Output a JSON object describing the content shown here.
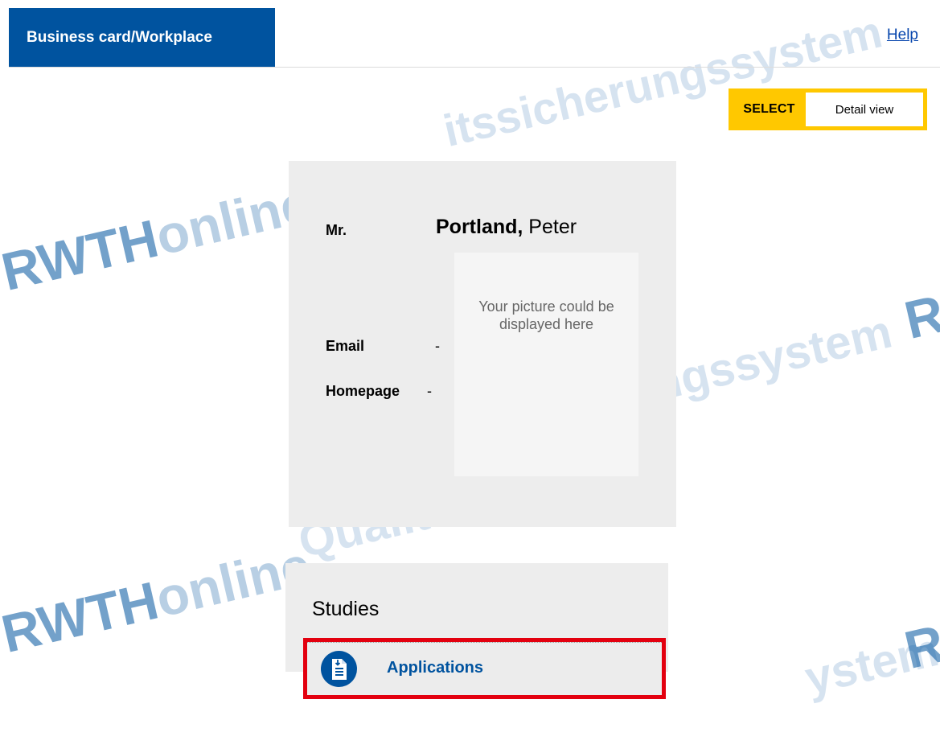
{
  "header": {
    "tab_label": "Business card/Workplace",
    "help_label": "Help"
  },
  "select": {
    "label": "SELECT",
    "value": "Detail view"
  },
  "card": {
    "salutation": "Mr.",
    "last_name": "Portland,",
    "first_name": "Peter",
    "photo_placeholder": "Your picture could be displayed here",
    "email_label": "Email",
    "email_value": "-",
    "homepage_label": "Homepage",
    "homepage_value": "-"
  },
  "studies": {
    "title": "Studies",
    "items": [
      {
        "label": "Applications",
        "icon": "document-download-icon"
      }
    ]
  },
  "watermark": {
    "brand_a": "RWTH",
    "brand_b": "online",
    "tagline_1": "itssicherungssystem",
    "tagline_2": "ngssystem",
    "tagline_3": "Qualit",
    "tagline_4": "ystem",
    "edge": "R"
  },
  "colors": {
    "brand_blue": "#00539f",
    "select_yellow": "#ffc800",
    "highlight_red": "#e3000f",
    "card_grey": "#ededed"
  }
}
